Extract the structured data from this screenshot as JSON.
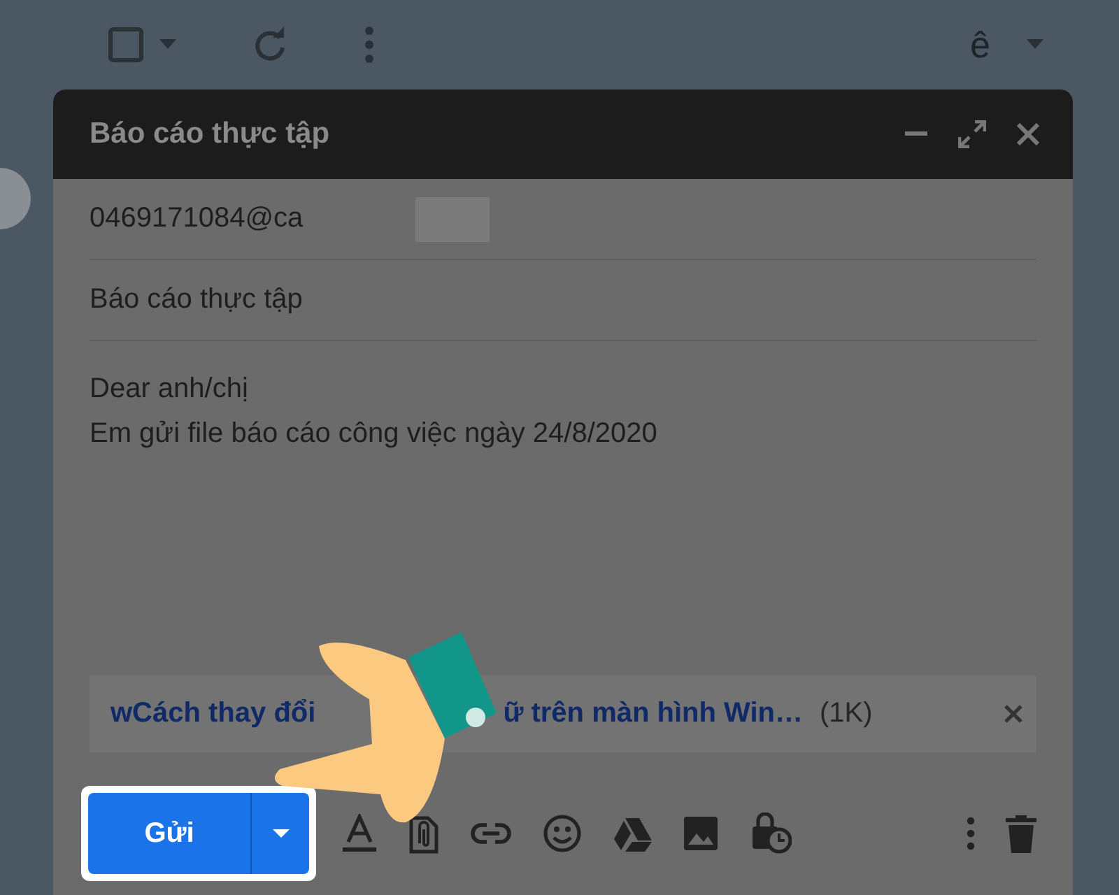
{
  "toolbar": {
    "account_letter": "ê"
  },
  "compose": {
    "title": "Báo cáo thực tập",
    "to": "0469171084@ca",
    "subject": "Báo cáo thực tập",
    "body_lines": [
      "Dear anh/chị",
      "Em gửi file báo cáo công việc ngày 24/8/2020"
    ],
    "attachment": {
      "name_start": "wCách thay đổi",
      "name_end": "ữ trên màn hình Win…",
      "size": "(1K)"
    },
    "send_label": "Gửi"
  }
}
